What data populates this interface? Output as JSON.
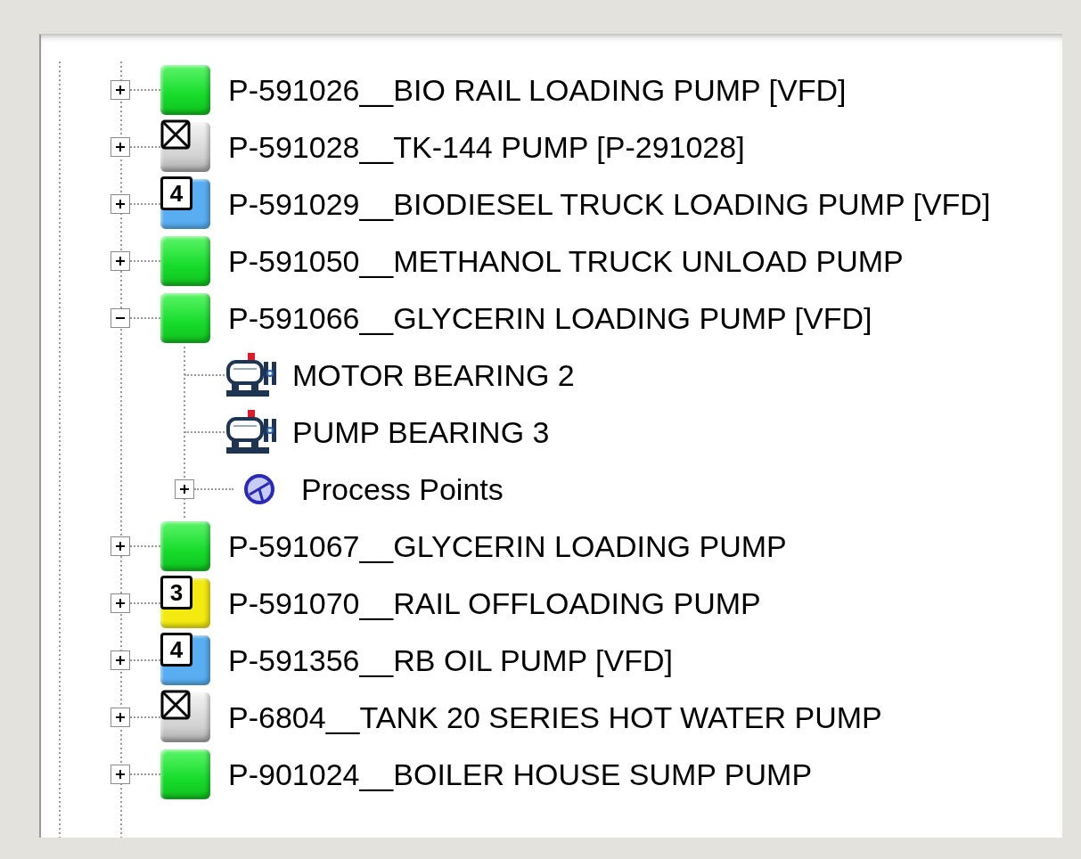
{
  "tree": {
    "nodes": [
      {
        "label": "P-591026__BIO RAIL LOADING PUMP [VFD]",
        "kind": "ok",
        "expanded": false
      },
      {
        "label": "P-591028__TK-144 PUMP  [P-291028]",
        "kind": "off",
        "expanded": false
      },
      {
        "label": "P-591029__BIODIESEL TRUCK LOADING PUMP [VFD]",
        "kind": "alarm",
        "badge": "4",
        "color": "#58aef0",
        "expanded": false
      },
      {
        "label": "P-591050__METHANOL TRUCK UNLOAD PUMP",
        "kind": "ok",
        "expanded": false
      },
      {
        "label": "P-591066__GLYCERIN LOADING PUMP [VFD]",
        "kind": "ok",
        "expanded": true,
        "children": [
          {
            "label": "MOTOR BEARING 2",
            "kind": "bearing"
          },
          {
            "label": "PUMP BEARING 3",
            "kind": "bearing"
          },
          {
            "label": "Process Points",
            "kind": "process",
            "expanded": false
          }
        ]
      },
      {
        "label": "P-591067__GLYCERIN LOADING PUMP",
        "kind": "ok",
        "expanded": false
      },
      {
        "label": "P-591070__RAIL OFFLOADING PUMP",
        "kind": "alarm",
        "badge": "3",
        "color": "#f2ea10",
        "expanded": false
      },
      {
        "label": "P-591356__RB OIL PUMP [VFD]",
        "kind": "alarm",
        "badge": "4",
        "color": "#58aef0",
        "expanded": false
      },
      {
        "label": "P-6804__TANK 20 SERIES HOT WATER PUMP",
        "kind": "off",
        "expanded": false
      },
      {
        "label": "P-901024__BOILER HOUSE SUMP PUMP",
        "kind": "ok",
        "expanded": false
      }
    ]
  }
}
